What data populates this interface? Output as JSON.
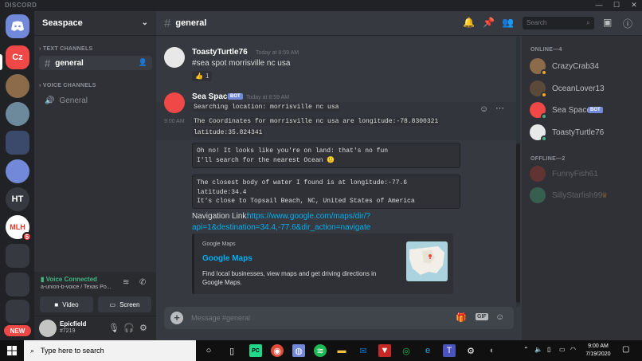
{
  "window": {
    "brand": "DISCORD",
    "min": "—",
    "max": "☐",
    "close": "✕"
  },
  "guilds": {
    "items": [
      {
        "label": "Cz",
        "color": "#f04747"
      },
      {
        "label": "",
        "color": "#8b6b4a"
      },
      {
        "label": "",
        "color": "#6d8a9c"
      },
      {
        "label": "",
        "color": "#3b4a6b"
      },
      {
        "label": "",
        "color": "#7289da"
      },
      {
        "label": "HT",
        "color": "#36393f"
      },
      {
        "label": "MLH",
        "color": "#ffffff"
      },
      {
        "label": "",
        "color": "#36393f"
      },
      {
        "label": "",
        "color": "#36393f"
      },
      {
        "label": "",
        "color": "#36393f"
      }
    ],
    "mlh_badge": "5",
    "new_label": "NEW"
  },
  "sidebar": {
    "server_name": "Seaspace",
    "text_category": "TEXT CHANNELS",
    "voice_category": "VOICE CHANNELS",
    "text_channel": "general",
    "voice_channel": "General"
  },
  "voice": {
    "status": "Voice Connected",
    "sub": "a-union-b-voice / Texas Po...",
    "video_label": "Video",
    "screen_label": "Screen"
  },
  "user": {
    "name": "Epicfield",
    "tag": "#7219"
  },
  "header": {
    "channel": "general",
    "search_placeholder": "Search"
  },
  "messages": {
    "m1": {
      "author": "ToastyTurtle76",
      "time": "Today at 8:59 AM",
      "text": "#sea spot morrisville nc usa",
      "reaction_emoji": "👍",
      "reaction_count": "1"
    },
    "m2": {
      "author": "Sea Space",
      "bot": "BOT",
      "time": "Today at 8:59 AM",
      "side_time": "9:00 AM",
      "line1": "Searching location: morrisville nc usa",
      "line2": "The Coordinates for morrisville nc usa are longitude:-78.8300321",
      "line3": "latitude:35.824341",
      "block1": "Oh no! It looks like you're on land: that's no fun\nI'll search for the nearest Ocean 🙂",
      "block2": "The closest body of water I found is at longitude:-77.6\nlatitude:34.4\nIt's close to Topsail Beach, NC, United States of America",
      "nav_label": "Navigation Link: ",
      "nav_url_1": "https://www.google.com/maps/dir/?",
      "nav_url_2": "api=1&destination=34.4,-77.6&dir_action=navigate",
      "embed_provider": "Google Maps",
      "embed_title": "Google Maps",
      "embed_desc": "Find local businesses, view maps and get driving directions in Google Maps."
    }
  },
  "input": {
    "placeholder": "Message #general",
    "gif": "GIF"
  },
  "members": {
    "online_label": "ONLINE—4",
    "offline_label": "OFFLINE—2",
    "bot_tag": "BOT",
    "online": [
      {
        "name": "CrazyCrab34",
        "color": "#8b6b4a",
        "status": "#faa61a"
      },
      {
        "name": "OceanLover13",
        "color": "#5b4a3a",
        "status": "#faa61a"
      },
      {
        "name": "Sea Space",
        "color": "#f04747",
        "status": "#43b581"
      },
      {
        "name": "ToastyTurtle76",
        "color": "#e8e8e8",
        "status": "#43b581"
      }
    ],
    "offline": [
      {
        "name": "FunnyFish61",
        "color": "#c0392b"
      },
      {
        "name": "SillyStarfish99",
        "color": "#43b581"
      }
    ]
  },
  "taskbar": {
    "search_placeholder": "Type here to search",
    "time": "9:00 AM",
    "date": "7/19/2020"
  }
}
